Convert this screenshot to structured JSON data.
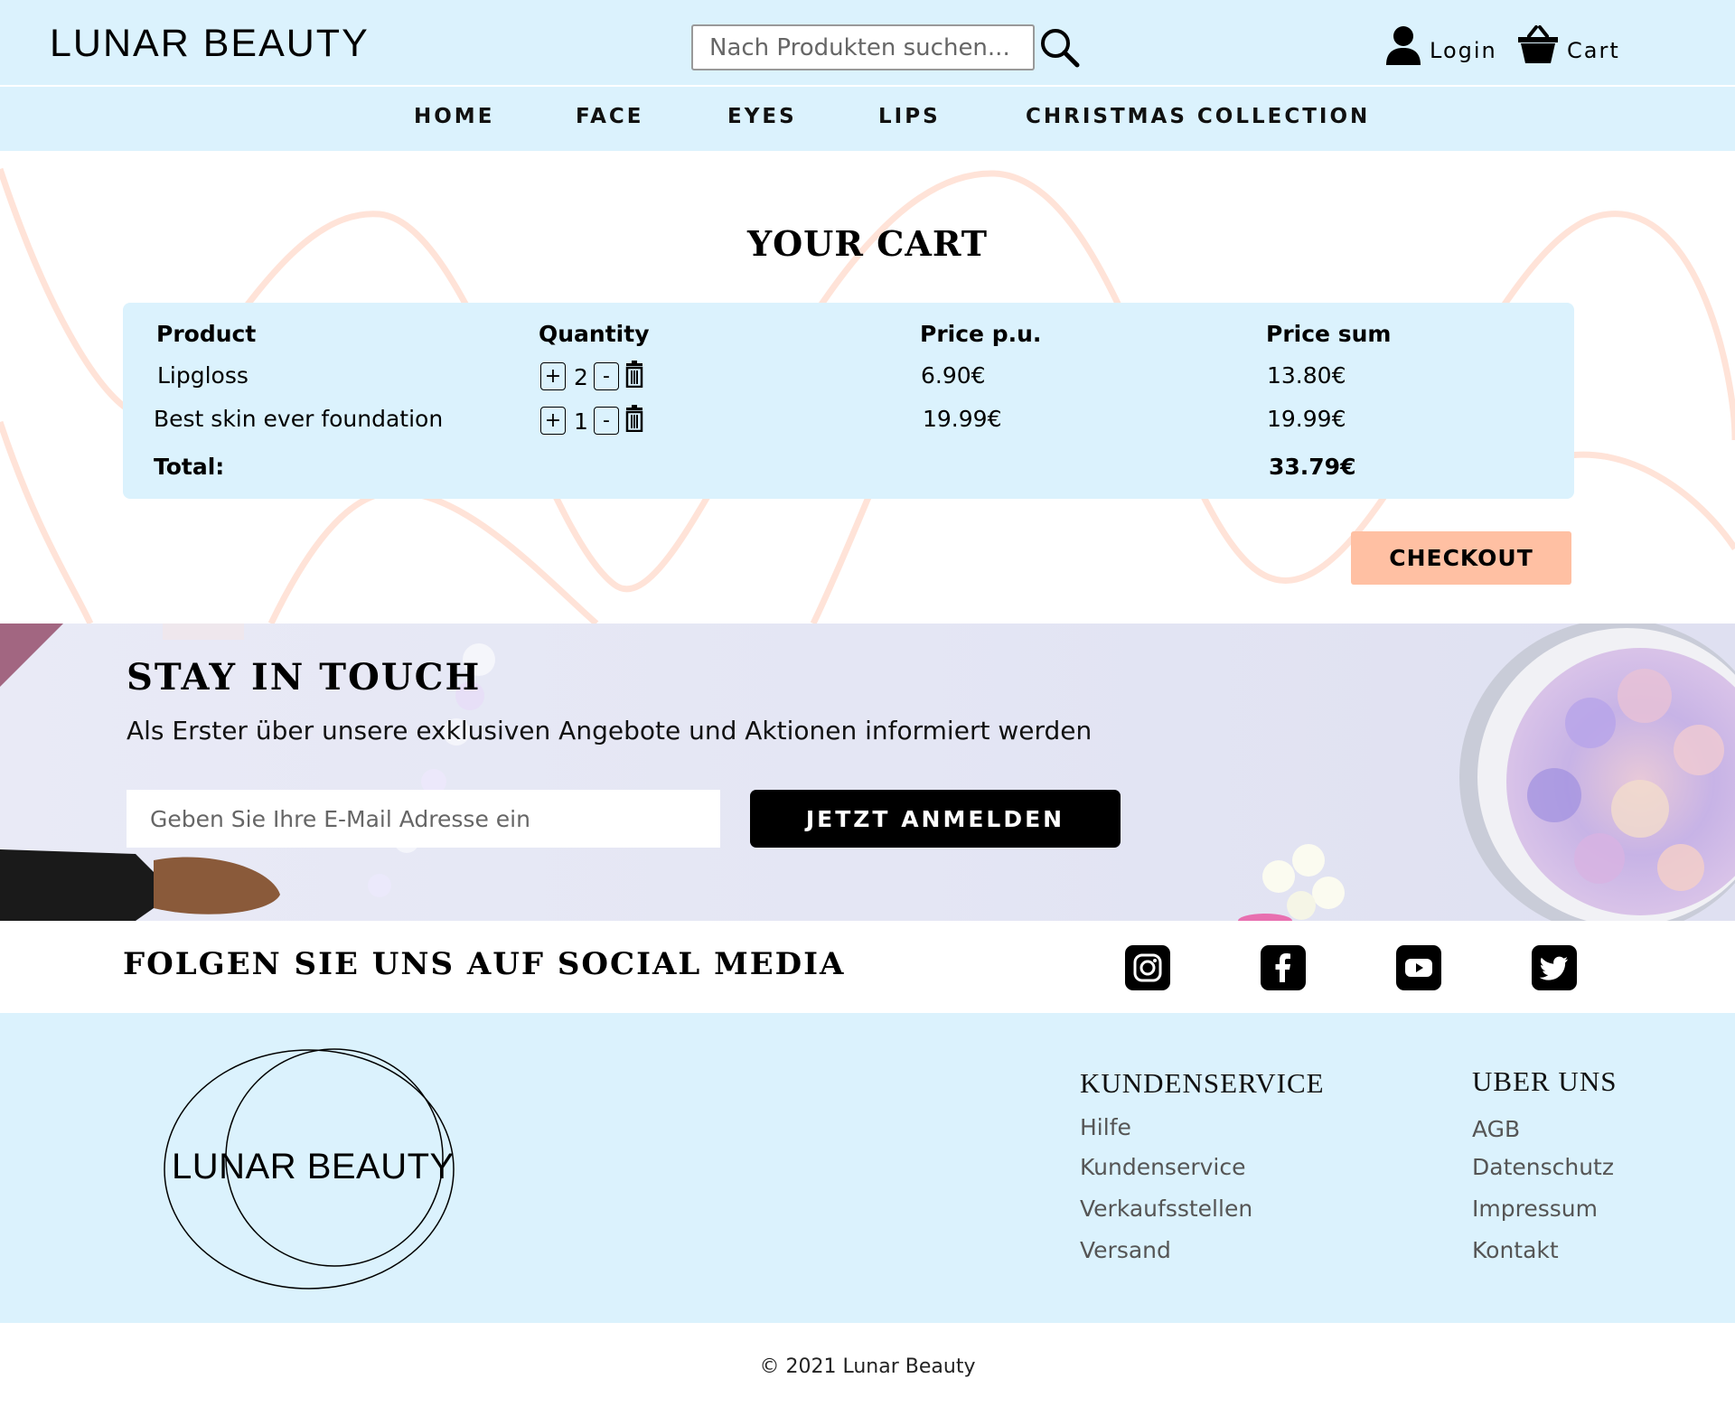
{
  "header": {
    "logo": "LUNAR BEAUTY",
    "search_placeholder": "Nach Produkten suchen...",
    "login_label": "Login",
    "cart_label": "Cart"
  },
  "nav": {
    "items": [
      "HOME",
      "FACE",
      "EYES",
      "LIPS",
      "CHRISTMAS COLLECTION"
    ]
  },
  "cart": {
    "title": "YOUR CART",
    "columns": [
      "Product",
      "Quantity",
      "Price p.u.",
      "Price sum"
    ],
    "rows": [
      {
        "product": "Lipgloss",
        "quantity": "2",
        "price_unit": "6.90€",
        "price_sum": "13.80€"
      },
      {
        "product": "Best skin ever foundation",
        "quantity": "1",
        "price_unit": "19.99€",
        "price_sum": "19.99€"
      }
    ],
    "plus_label": "+",
    "minus_label": "-",
    "total_label": "Total:",
    "total_value": "33.79€",
    "checkout_label": "CHECKOUT"
  },
  "newsletter": {
    "title": "STAY IN TOUCH",
    "text": "Als Erster über unsere exklusiven Angebote und Aktionen informiert werden",
    "email_placeholder": "Geben Sie Ihre E-Mail Adresse ein",
    "button_label": "JETZT ANMELDEN"
  },
  "social": {
    "title": "FOLGEN SIE UNS AUF SOCIAL MEDIA",
    "icons": [
      "instagram-icon",
      "facebook-icon",
      "youtube-icon",
      "twitter-icon"
    ]
  },
  "footer": {
    "logo_text": "LUNAR BEAUTY",
    "columns": [
      {
        "title": "KUNDENSERVICE",
        "links": [
          "Hilfe",
          "Kundenservice",
          "Verkaufsstellen",
          "Versand"
        ]
      },
      {
        "title": "UBER UNS",
        "links": [
          "AGB",
          "Datenschutz",
          "Impressum",
          "Kontakt"
        ]
      }
    ],
    "copyright": "© 2021 Lunar Beauty"
  },
  "colors": {
    "header_bg": "#dbf2fd",
    "checkout_bg": "#ffc0a3",
    "wave": "#ffe3d8",
    "subscribe_bg": "#000000"
  }
}
